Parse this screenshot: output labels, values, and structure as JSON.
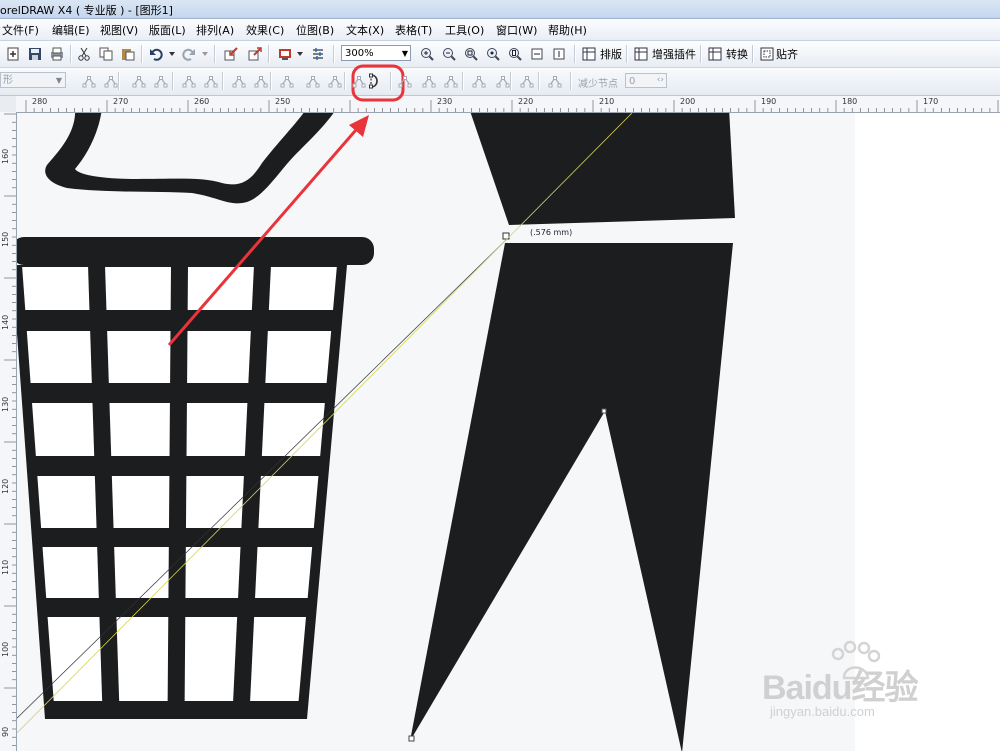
{
  "window": {
    "title": "orelDRAW X4 ( 专业版 ) - [图形1]"
  },
  "menu": [
    {
      "label": "文件(F)"
    },
    {
      "label": "编辑(E)"
    },
    {
      "label": "视图(V)"
    },
    {
      "label": "版面(L)"
    },
    {
      "label": "排列(A)"
    },
    {
      "label": "效果(C)"
    },
    {
      "label": "位图(B)"
    },
    {
      "label": "文本(X)"
    },
    {
      "label": "表格(T)"
    },
    {
      "label": "工具(O)"
    },
    {
      "label": "窗口(W)"
    },
    {
      "label": "帮助(H)"
    }
  ],
  "toolbar": {
    "zoom": "300%",
    "buttons": {
      "imposition": "排版",
      "plugins": "增强插件",
      "convert": "转换",
      "snap": "贴齐"
    }
  },
  "property_bar": {
    "shape_select": "形",
    "reduce_nodes_label": "减少节点",
    "reduce_nodes_value": "0"
  },
  "ruler": {
    "horizontal": [
      "280",
      "270",
      "260",
      "250",
      "230",
      "220",
      "210",
      "200",
      "190",
      "180",
      "170"
    ],
    "vertical": [
      "160",
      "150",
      "140",
      "130",
      "120",
      "110",
      "100",
      "90"
    ]
  },
  "canvas": {
    "tooltip": "(.576 mm)",
    "fill_color": "#1c1d1e",
    "annotation_color": "#e8343a",
    "guide_color": "#d8d35a"
  },
  "watermark": {
    "brand": "Baidu经验",
    "url": "jingyan.baidu.com"
  }
}
